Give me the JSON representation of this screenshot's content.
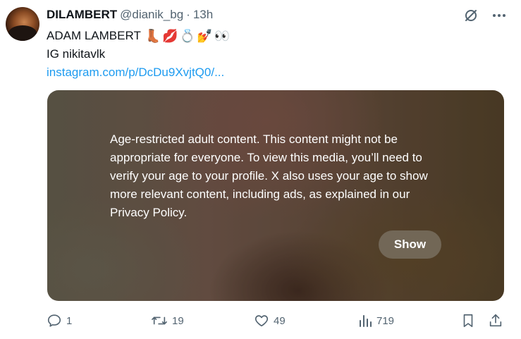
{
  "tweet": {
    "display_name": "DILAMBERT",
    "handle": "@dianik_bg",
    "separator": "·",
    "time": "13h",
    "text_line1": "ADAM LAMBERT",
    "emojis": [
      "👢",
      "💋",
      "💍",
      "💅",
      "👀"
    ],
    "text_line2": "IG nikitavlk",
    "link": "instagram.com/p/DcDu9XvjtQ0/..."
  },
  "media": {
    "notice": "Age-restricted adult content. This content might not be appropriate for everyone. To view this media, you’ll need to verify your age to your profile. X also uses your age to show more relevant content, including ads, as explained in our Privacy Policy.",
    "show_label": "Show"
  },
  "actions": {
    "replies": "1",
    "reposts": "19",
    "likes": "49",
    "views": "719"
  },
  "colors": {
    "link": "#1d9bf0",
    "muted": "#536471",
    "text": "#0f1419"
  }
}
